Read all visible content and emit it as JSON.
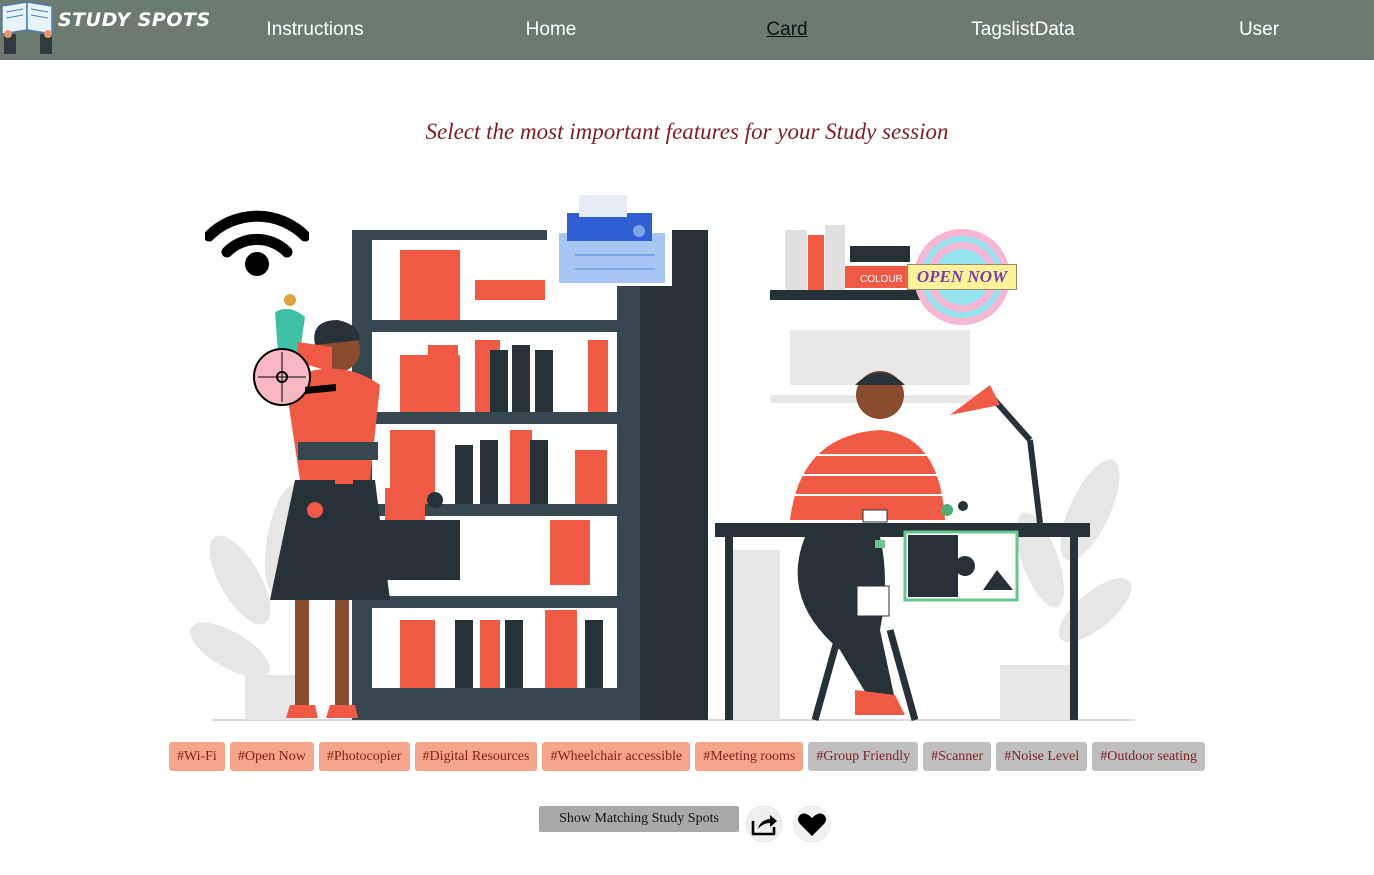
{
  "nav": {
    "logo_text": "STUDY SPOTS",
    "links": [
      "Instructions",
      "Home",
      "Card",
      "TagslistData",
      "User"
    ],
    "active": "Card"
  },
  "main": {
    "heading": "Select the most important features for your Study session",
    "open_now_badge": "OPEN NOW",
    "colour_label": "COLOUR"
  },
  "tags": [
    {
      "label": "#Wi-Fi",
      "selected": true
    },
    {
      "label": "#Open Now",
      "selected": true
    },
    {
      "label": "#Photocopier",
      "selected": true
    },
    {
      "label": "#Digital Resources",
      "selected": true
    },
    {
      "label": "#Wheelchair accessible",
      "selected": true
    },
    {
      "label": "#Meeting rooms",
      "selected": true
    },
    {
      "label": "#Group Friendly",
      "selected": false
    },
    {
      "label": "#Scanner",
      "selected": false
    },
    {
      "label": "#Noise Level",
      "selected": false
    },
    {
      "label": "#Outdoor seating",
      "selected": false
    }
  ],
  "actions": {
    "show_label": "Show Matching Study Spots",
    "share_icon": "share-icon",
    "favorite_icon": "heart-icon"
  },
  "colors": {
    "nav_bg": "#6c7b71",
    "heading": "#7d1f22",
    "tag_selected": "#f6a58a",
    "tag_unselected": "#bfbfbf",
    "accent": "#f05a45"
  }
}
